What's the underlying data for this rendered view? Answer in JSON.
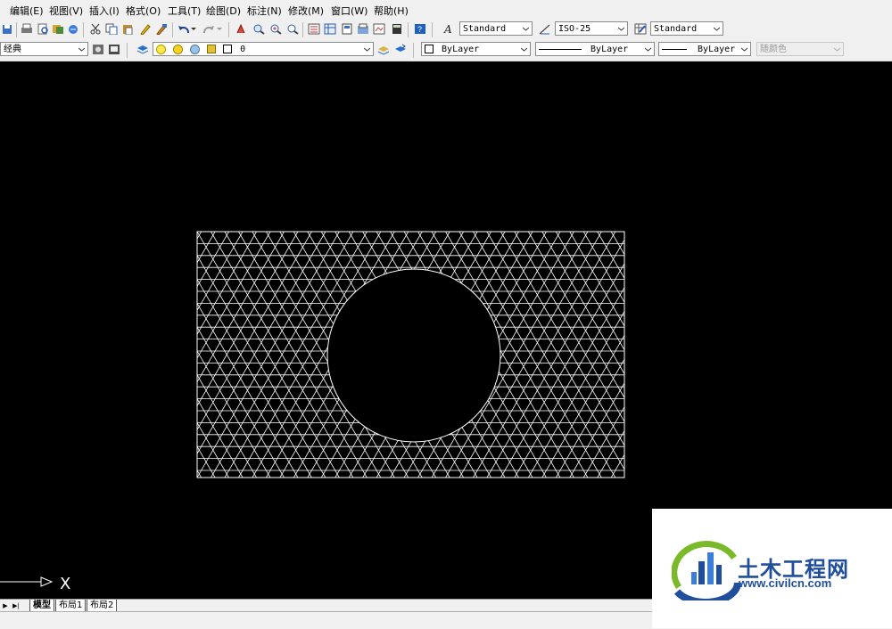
{
  "menu": [
    "编辑(E)",
    "视图(V)",
    "插入(I)",
    "格式(O)",
    "工具(T)",
    "绘图(D)",
    "标注(N)",
    "修改(M)",
    "窗口(W)",
    "帮助(H)"
  ],
  "toolbar1": {
    "text_style": "Standard",
    "dim_style": "ISO-25",
    "table_style": "Standard"
  },
  "toolbar2": {
    "workspace": "经典",
    "layer": "0",
    "color": "ByLayer",
    "linetype": "ByLayer",
    "lineweight": "ByLayer",
    "plot_style": "随颜色"
  },
  "canvas": {
    "ucs_x_label": "X"
  },
  "tabs": [
    "模型",
    "布局1",
    "布局2"
  ],
  "active_tab": "模型",
  "watermark": {
    "title": "土木工程网",
    "url": "www.civilcn.com"
  },
  "colors": {
    "canvas_bg": "#000000",
    "drawing_lines": "#ffffff",
    "watermark_blue": "#1f4e9c",
    "watermark_green": "#7ab929"
  }
}
